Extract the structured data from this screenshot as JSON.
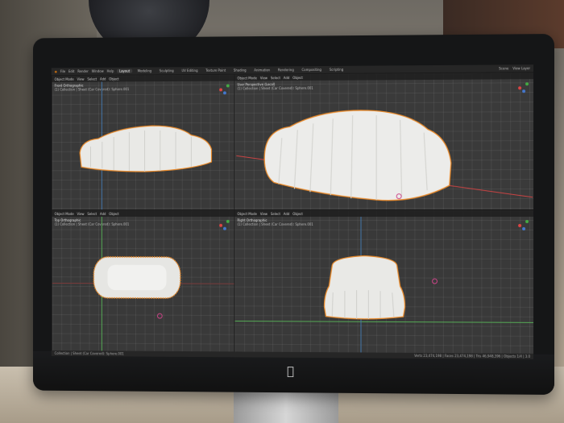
{
  "app": {
    "menu": [
      "File",
      "Edit",
      "Render",
      "Window",
      "Help"
    ],
    "workspaces": [
      "Layout",
      "Modeling",
      "Sculpting",
      "UV Editing",
      "Texture Paint",
      "Shading",
      "Animation",
      "Rendering",
      "Compositing",
      "Scripting"
    ],
    "active_workspace": "Layout",
    "scene_label": "Scene",
    "view_layer_label": "View Layer"
  },
  "viewports": {
    "front": {
      "header": [
        "Object Mode",
        "View",
        "Select",
        "Add",
        "Object"
      ],
      "title": "Front Orthographic",
      "collection": "(1) Collection | Sheet (Car Covered): Sphere.001"
    },
    "persp": {
      "header": [
        "Object Mode",
        "View",
        "Select",
        "Add",
        "Object"
      ],
      "title": "User Perspective (Local)",
      "collection": "(1) Collection | Sheet (Car Covered): Sphere.001"
    },
    "top": {
      "header": [
        "Object Mode",
        "View",
        "Select",
        "Add",
        "Object"
      ],
      "title": "Top Orthographic",
      "collection": "(1) Collection | Sheet (Car Covered): Sphere.001"
    },
    "right": {
      "header": [
        "Object Mode",
        "View",
        "Select",
        "Add",
        "Object"
      ],
      "title": "Right Orthographic",
      "collection": "(1) Collection | Sheet (Car Covered): Sphere.001"
    }
  },
  "statusbar": {
    "left": "Collection | Sheet (Car Covered): Sphere.001",
    "stats": "Verts 23,474,198 | Faces 23,474,198 | Tris 46,948,396 | Objects 1/4 | 3.0"
  },
  "colors": {
    "selection_outline": "#e8892a",
    "car_fill": "#e9e9e6",
    "viewport_bg": "#393939"
  }
}
